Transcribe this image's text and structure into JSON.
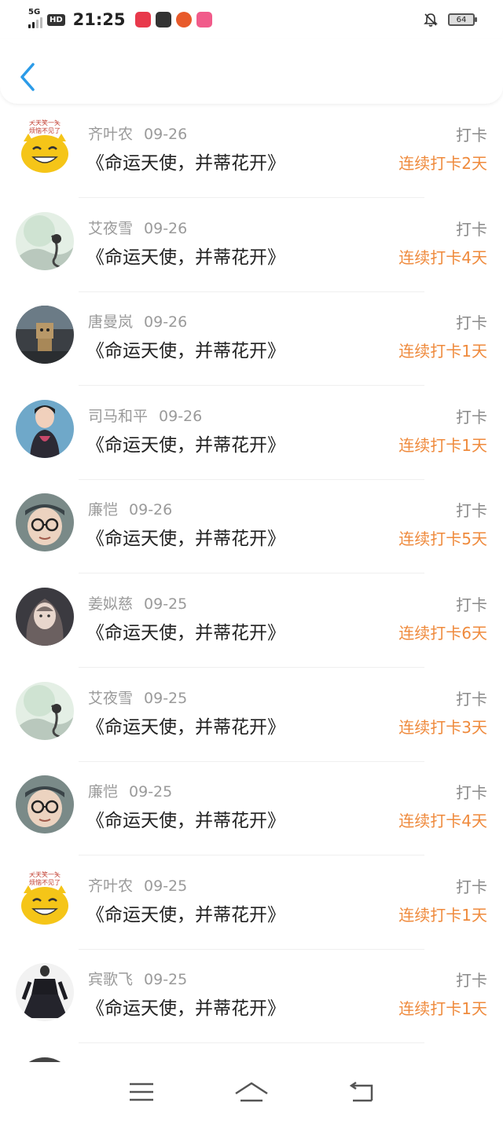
{
  "status_bar": {
    "network": "5G",
    "hd_label": "HD",
    "time": "21:25",
    "battery": "64",
    "app_badges": [
      {
        "color": "#e8394b",
        "icon": "app-icon-red"
      },
      {
        "color": "#333333",
        "icon": "app-icon-notebook"
      },
      {
        "color": "#e85a2a",
        "icon": "app-icon-basket"
      },
      {
        "color": "#f15b8a",
        "icon": "app-icon-pink"
      }
    ]
  },
  "header": {
    "back_icon": "chevron-left-icon",
    "accent": "#2b9be8"
  },
  "colors": {
    "streak": "#ef8a3c",
    "name": "#9a9a9a",
    "book": "#222222"
  },
  "checkins": [
    {
      "name": "齐叶农",
      "date": "09-26",
      "book": "《命运天使，并蒂花开》",
      "action": "打卡",
      "streak": "连续打卡2天",
      "avatar": "cartoon-face"
    },
    {
      "name": "艾夜雪",
      "date": "09-26",
      "book": "《命运天使，并蒂花开》",
      "action": "打卡",
      "streak": "连续打卡4天",
      "avatar": "ink-painting"
    },
    {
      "name": "唐曼岚",
      "date": "09-26",
      "book": "《命运天使，并蒂花开》",
      "action": "打卡",
      "streak": "连续打卡1天",
      "avatar": "cardboard-robot"
    },
    {
      "name": "司马和平",
      "date": "09-26",
      "book": "《命运天使，并蒂花开》",
      "action": "打卡",
      "streak": "连续打卡1天",
      "avatar": "woman-portrait"
    },
    {
      "name": "廉恺",
      "date": "09-26",
      "book": "《命运天使，并蒂花开》",
      "action": "打卡",
      "streak": "连续打卡5天",
      "avatar": "boy-glasses"
    },
    {
      "name": "姜姒慈",
      "date": "09-25",
      "book": "《命运天使，并蒂花开》",
      "action": "打卡",
      "streak": "连续打卡6天",
      "avatar": "fantasy-girl"
    },
    {
      "name": "艾夜雪",
      "date": "09-25",
      "book": "《命运天使，并蒂花开》",
      "action": "打卡",
      "streak": "连续打卡3天",
      "avatar": "ink-painting"
    },
    {
      "name": "廉恺",
      "date": "09-25",
      "book": "《命运天使，并蒂花开》",
      "action": "打卡",
      "streak": "连续打卡4天",
      "avatar": "boy-glasses"
    },
    {
      "name": "齐叶农",
      "date": "09-25",
      "book": "《命运天使，并蒂花开》",
      "action": "打卡",
      "streak": "连续打卡1天",
      "avatar": "cartoon-face"
    },
    {
      "name": "宾歌飞",
      "date": "09-25",
      "book": "《命运天使，并蒂花开》",
      "action": "打卡",
      "streak": "连续打卡1天",
      "avatar": "black-dress"
    }
  ],
  "nav": [
    {
      "icon": "menu-icon"
    },
    {
      "icon": "home-icon"
    },
    {
      "icon": "back-icon"
    }
  ]
}
